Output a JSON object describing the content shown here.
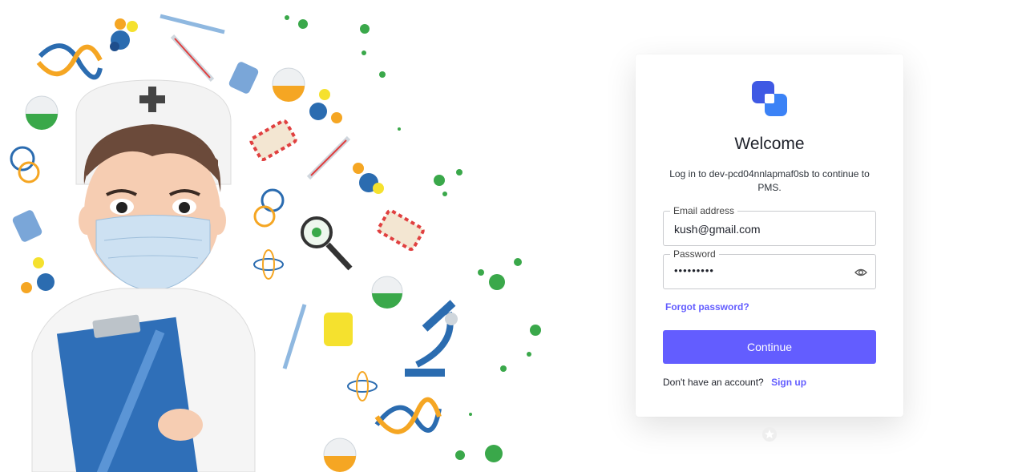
{
  "login": {
    "title": "Welcome",
    "subtitle": "Log in to dev-pcd04nnlapmaf0sb to continue to PMS.",
    "email_label": "Email address",
    "email_value": "kush@gmail.com",
    "password_label": "Password",
    "password_value": "•••••••••",
    "forgot_label": "Forgot password?",
    "continue_label": "Continue",
    "signup_prompt": "Don't have an account?",
    "signup_label": "Sign up"
  },
  "colors": {
    "accent": "#635dff",
    "logo_primary": "#3f59e4",
    "logo_secondary": "#3b82f6"
  },
  "icons": {
    "logo": "overlapping-squares-logo",
    "password_toggle": "eye-icon",
    "bottom_badge": "star-badge-icon"
  },
  "illustration": {
    "subject": "nurse-with-mask-and-clipboard",
    "elements": [
      "dna-icon",
      "syringe-icon",
      "flask-icon",
      "pills-icon",
      "virus-icon",
      "microscope-icon",
      "magnifier-icon",
      "atom-icon",
      "thermometer-icon",
      "molecule-icon",
      "medicine-bottle-icon"
    ]
  }
}
